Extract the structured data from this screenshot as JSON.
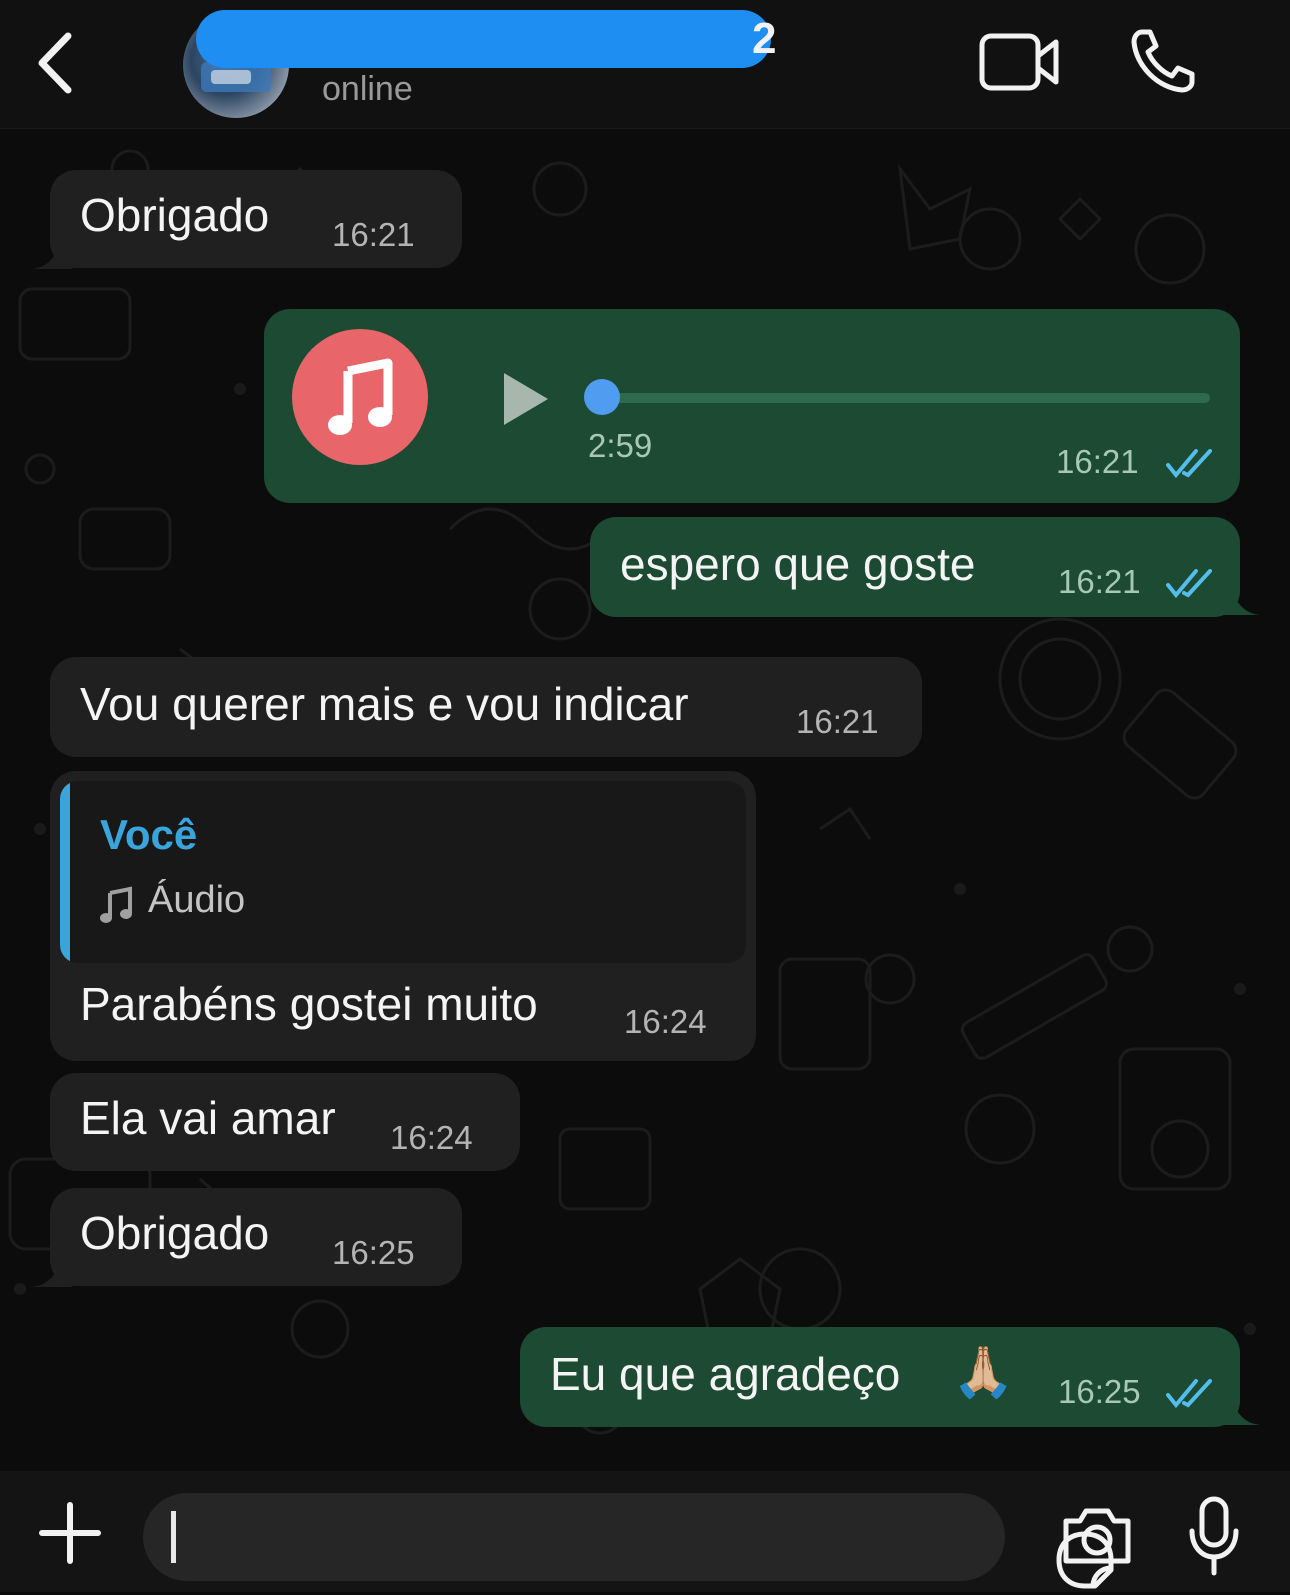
{
  "header": {
    "contact_visible_digit": "2",
    "status": "online",
    "back_icon": "chevron-left-icon",
    "video_icon": "video-camera-icon",
    "call_icon": "phone-icon"
  },
  "messages": [
    {
      "direction": "in",
      "text": "Obrigado",
      "time": "16:21"
    },
    {
      "direction": "out",
      "type": "audio",
      "duration": "2:59",
      "progress": 0,
      "time": "16:21",
      "read": true,
      "icon": "music-note-icon"
    },
    {
      "direction": "out",
      "text": "espero que goste",
      "time": "16:21",
      "read": true
    },
    {
      "direction": "in",
      "text": "Vou querer mais e vou indicar",
      "time": "16:21"
    },
    {
      "direction": "in",
      "reply": {
        "author": "Você",
        "label": "Áudio",
        "icon": "music-note-icon"
      },
      "text": "Parabéns gostei muito",
      "time": "16:24"
    },
    {
      "direction": "in",
      "text": "Ela vai amar",
      "time": "16:24"
    },
    {
      "direction": "in",
      "text": "Obrigado",
      "time": "16:25"
    },
    {
      "direction": "out",
      "text": "Eu que agradeço",
      "emoji": "🙏🏼",
      "time": "16:25",
      "read": true
    }
  ],
  "composer": {
    "plus_icon": "plus-icon",
    "sticker_icon": "sticker-icon",
    "camera_icon": "camera-icon",
    "mic_icon": "microphone-icon"
  },
  "colors": {
    "incoming_bubble": "#202020",
    "outgoing_bubble": "#1c4a33",
    "read_ticks": "#53bdeb",
    "audio_avatar": "#e8656a",
    "reply_accent": "#3aa5dc"
  }
}
